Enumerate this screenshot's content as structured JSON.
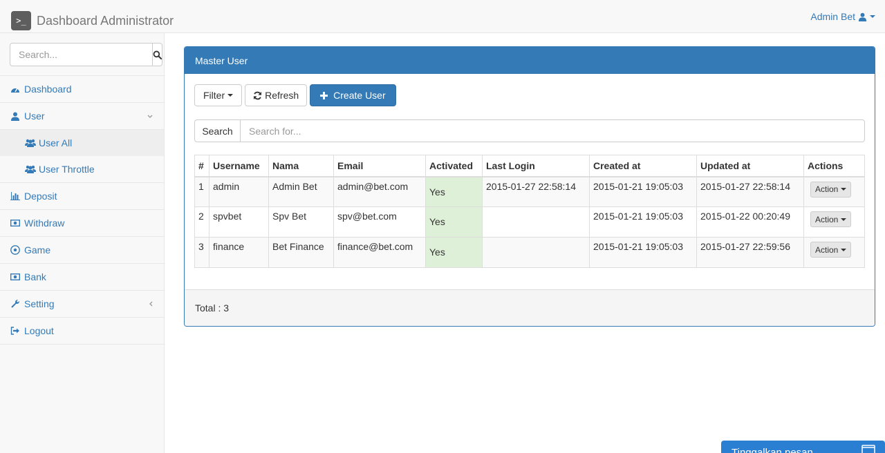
{
  "navbar": {
    "brand_logo": ">_",
    "brand_title": "Dashboard Administrator",
    "user_label": "Admin Bet"
  },
  "sidebar": {
    "search_placeholder": "Search...",
    "items": [
      {
        "label": "Dashboard",
        "icon": "dashboard-icon"
      },
      {
        "label": "User",
        "icon": "user-icon",
        "expanded": true,
        "children": [
          {
            "label": "User All",
            "icon": "users-icon",
            "selected": true
          },
          {
            "label": "User Throttle",
            "icon": "users-icon"
          }
        ]
      },
      {
        "label": "Deposit",
        "icon": "bar-chart-icon"
      },
      {
        "label": "Withdraw",
        "icon": "money-icon"
      },
      {
        "label": "Game",
        "icon": "soccer-ball-icon"
      },
      {
        "label": "Bank",
        "icon": "money-icon"
      },
      {
        "label": "Setting",
        "icon": "wrench-icon"
      },
      {
        "label": "Logout",
        "icon": "sign-out-icon"
      }
    ]
  },
  "panel": {
    "title": "Master User",
    "toolbar": {
      "filter_label": "Filter",
      "refresh_label": "Refresh",
      "create_label": "Create User"
    },
    "search": {
      "button_label": "Search",
      "placeholder": "Search for..."
    },
    "table": {
      "headers": [
        "#",
        "Username",
        "Nama",
        "Email",
        "Activated",
        "Last Login",
        "Created at",
        "Updated at",
        "Actions"
      ],
      "rows": [
        {
          "no": "1",
          "username": "admin",
          "nama": "Admin Bet",
          "email": "admin@bet.com",
          "activated": "Yes",
          "last_login": "2015-01-27 22:58:14",
          "created_at": "2015-01-21 19:05:03",
          "updated_at": "2015-01-27 22:58:14",
          "action": "Action"
        },
        {
          "no": "2",
          "username": "spvbet",
          "nama": "Spv Bet",
          "email": "spv@bet.com",
          "activated": "Yes",
          "last_login": "",
          "created_at": "2015-01-21 19:05:03",
          "updated_at": "2015-01-22 00:20:49",
          "action": "Action"
        },
        {
          "no": "3",
          "username": "finance",
          "nama": "Bet Finance",
          "email": "finance@bet.com",
          "activated": "Yes",
          "last_login": "",
          "created_at": "2015-01-21 19:05:03",
          "updated_at": "2015-01-27 22:59:56",
          "action": "Action"
        }
      ]
    },
    "footer_total": "Total : 3"
  },
  "chat_widget": {
    "label": "Tinggalkan pesan"
  },
  "colors": {
    "primary": "#337ab7",
    "success_bg": "#dff0d8",
    "chat": "#2a7fd3"
  }
}
